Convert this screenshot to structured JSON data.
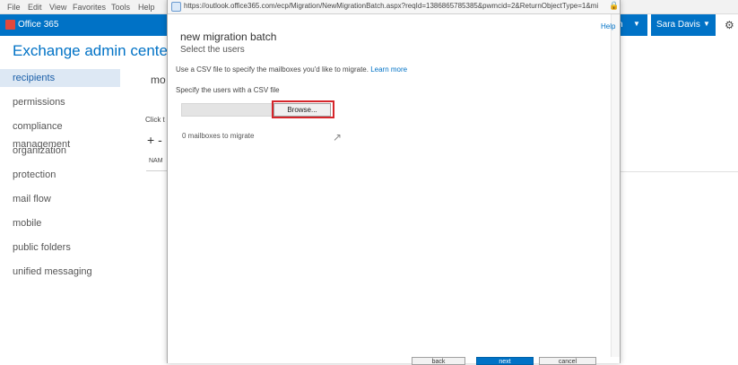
{
  "browser_menu": [
    "File",
    "Edit",
    "View",
    "Favorites",
    "Tools",
    "Help"
  ],
  "o365": {
    "brand": "Office 365",
    "user": "Sara Davis",
    "partial_label": "n",
    "caret": "▼",
    "gear": "⚙"
  },
  "eac": {
    "title": "Exchange admin center",
    "nav": [
      {
        "label": "recipients",
        "active": true
      },
      {
        "label": "permissions"
      },
      {
        "label": "compliance management"
      },
      {
        "label": "organization"
      },
      {
        "label": "protection"
      },
      {
        "label": "mail flow"
      },
      {
        "label": "mobile"
      },
      {
        "label": "public folders"
      },
      {
        "label": "unified messaging"
      }
    ],
    "fragments": {
      "tab": "mo",
      "click": "Click t",
      "add": "+ -",
      "column": "NAM"
    }
  },
  "dialog": {
    "url": "https://outlook.office365.com/ecp/Migration/NewMigrationBatch.aspx?reqId=1386865785385&pwmcid=2&ReturnObjectType=1&mi",
    "help": "Help",
    "title": "new migration batch",
    "subtitle": "Select the users",
    "description": "Use a CSV file to specify the mailboxes you'd like to migrate.",
    "learn_more": "Learn more",
    "csv_label": "Specify the users with a CSV file",
    "browse": "Browse...",
    "mailbox_count": "0 mailboxes to migrate",
    "footer_buttons": [
      "back",
      "next",
      "cancel"
    ]
  },
  "colors": {
    "accent": "#0072c6",
    "highlight": "#d6262b",
    "nav_active_bg": "#dde8f4"
  }
}
